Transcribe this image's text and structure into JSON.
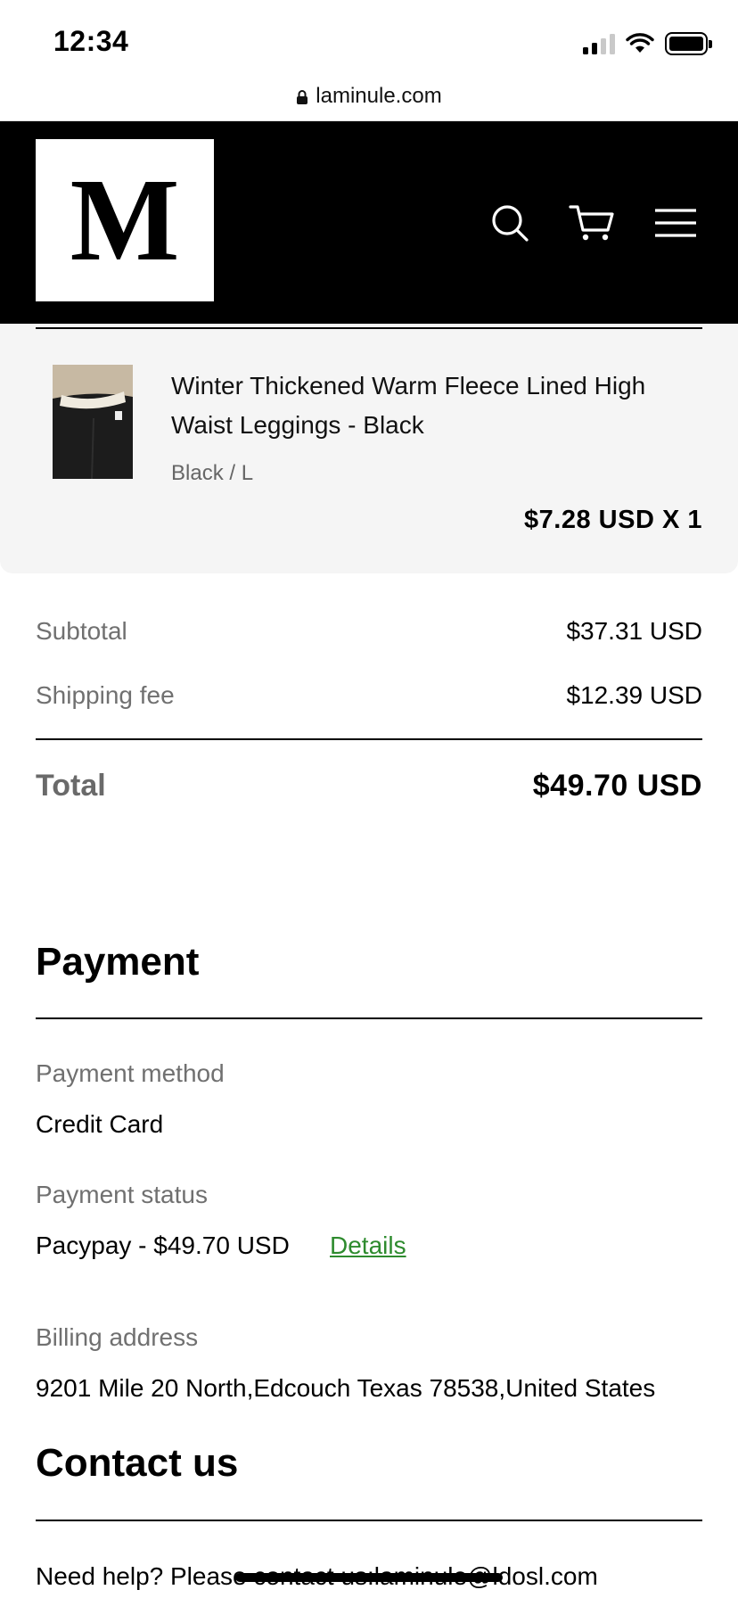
{
  "status_bar": {
    "time": "12:34"
  },
  "browser": {
    "url": "laminule.com"
  },
  "header": {
    "logo_letter": "M"
  },
  "product": {
    "title": "Winter Thickened Warm Fleece Lined High Waist Leggings - Black",
    "variant": "Black / L",
    "price": "$7.28 USD X 1"
  },
  "totals": {
    "subtotal_label": "Subtotal",
    "subtotal_value": "$37.31 USD",
    "shipping_label": "Shipping fee",
    "shipping_value": "$12.39 USD",
    "total_label": "Total",
    "total_value": "$49.70 USD"
  },
  "payment": {
    "title": "Payment",
    "method_label": "Payment method",
    "method_value": "Credit Card",
    "status_label": "Payment status",
    "status_value": "Pacypay - $49.70 USD",
    "details_link": "Details",
    "billing_label": "Billing address",
    "billing_value": "9201 Mile 20 North,Edcouch Texas 78538,United States"
  },
  "contact": {
    "title": "Contact us",
    "help_text": "Need help? Please contact us:laminule@ldosl.com"
  },
  "colors": {
    "header_bg": "#000000",
    "link_green": "#2e8b2e",
    "muted_text": "#707070",
    "product_bg": "#f5f5f5"
  },
  "icons": [
    "signal-icon",
    "wifi-icon",
    "battery-icon",
    "lock-icon",
    "search-icon",
    "cart-icon",
    "menu-icon"
  ]
}
